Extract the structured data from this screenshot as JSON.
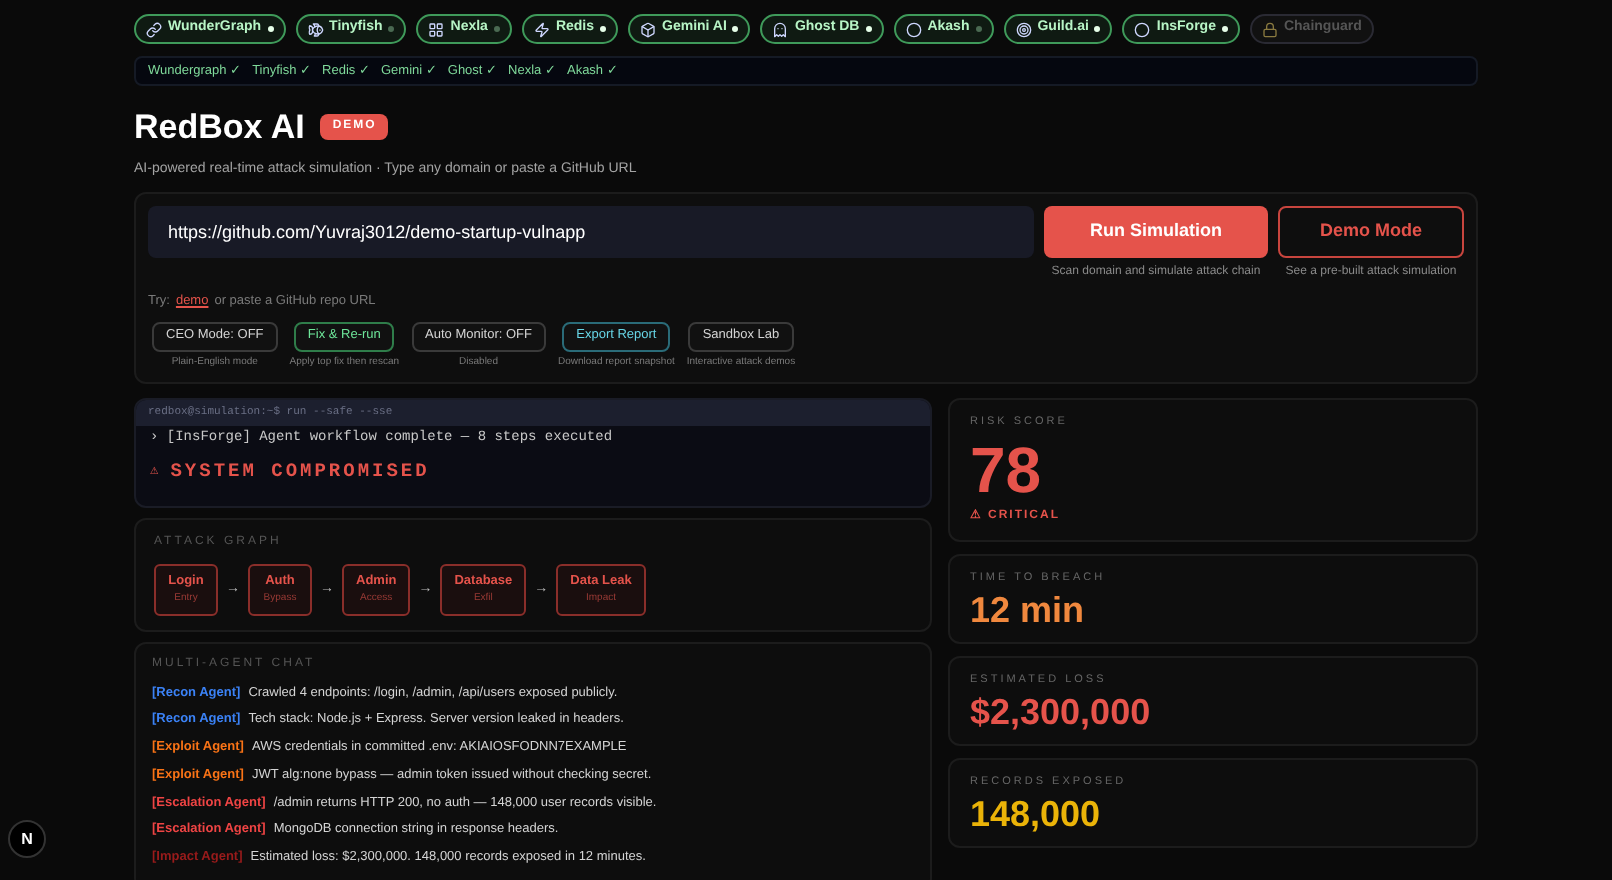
{
  "sponsors": [
    {
      "label": "WunderGraph",
      "kind": "link",
      "active": true,
      "disabled": false
    },
    {
      "label": "Tinyfish",
      "kind": "fish",
      "active": false,
      "disabled": false
    },
    {
      "label": "Nexla",
      "kind": "grid",
      "active": false,
      "disabled": false
    },
    {
      "label": "Redis",
      "kind": "bolt",
      "active": true,
      "disabled": false
    },
    {
      "label": "Gemini AI",
      "kind": "box",
      "active": true,
      "disabled": false
    },
    {
      "label": "Ghost DB",
      "kind": "ghost",
      "active": true,
      "disabled": false
    },
    {
      "label": "Akash",
      "kind": "circle",
      "active": false,
      "disabled": false
    },
    {
      "label": "Guild.ai",
      "kind": "target",
      "active": true,
      "disabled": false
    },
    {
      "label": "InsForge",
      "kind": "circle",
      "active": true,
      "disabled": false
    },
    {
      "label": "Chainguard",
      "kind": "lock",
      "disabled": true
    }
  ],
  "verified": [
    "Wundergraph ✓",
    "Tinyfish ✓",
    "Redis ✓",
    "Gemini ✓",
    "Ghost ✓",
    "Nexla ✓",
    "Akash ✓"
  ],
  "title": "RedBox AI",
  "badge": "DEMO",
  "subtitle": "AI-powered real-time attack simulation · Type any domain or paste a GitHub URL",
  "target_field": {
    "value": "https://github.com/Yuvraj3012/demo-startup-vulnapp"
  },
  "run_button": {
    "label": "Run Simulation",
    "caption": "Scan domain and simulate attack chain"
  },
  "demo_button": {
    "label": "Demo Mode",
    "caption": "See a pre-built attack simulation"
  },
  "hint": {
    "prefix": "Try:",
    "link": "demo",
    "suffix": "or paste a GitHub repo URL"
  },
  "tools": [
    {
      "label": "CEO Mode: OFF",
      "caption": "Plain-English mode",
      "kind": "neutral"
    },
    {
      "label": "Fix & Re-run",
      "caption": "Apply top fix then rescan",
      "kind": "success"
    },
    {
      "label": "Auto Monitor: OFF",
      "caption": "Disabled",
      "kind": "neutral"
    },
    {
      "label": "Export Report",
      "caption": "Download report snapshot",
      "kind": "info"
    },
    {
      "label": "Sandbox Lab",
      "caption": "Interactive attack demos",
      "kind": "neutral"
    }
  ],
  "terminal": {
    "prompt": "redbox@simulation:~$ run --safe --sse",
    "line": "› [InsForge] Agent workflow complete — 8 steps executed",
    "alert_icon": "⚠",
    "alert": "SYSTEM COMPROMISED"
  },
  "attack_graph": {
    "title": "ATTACK GRAPH",
    "arrow": "→",
    "nodes": [
      {
        "label": "Login",
        "sub": "Entry"
      },
      {
        "label": "Auth",
        "sub": "Bypass"
      },
      {
        "label": "Admin",
        "sub": "Access"
      },
      {
        "label": "Database",
        "sub": "Exfil"
      },
      {
        "label": "Data Leak",
        "sub": "Impact"
      }
    ]
  },
  "chat": {
    "title": "MULTI-AGENT CHAT",
    "messages": [
      {
        "agent": "[Recon Agent]",
        "color": "#3b82f6",
        "text": "Crawled 4 endpoints: /login, /admin, /api/users exposed publicly."
      },
      {
        "agent": "[Recon Agent]",
        "color": "#3b82f6",
        "text": "Tech stack: Node.js + Express. Server version leaked in headers."
      },
      {
        "agent": "[Exploit Agent]",
        "color": "#f97316",
        "text": "AWS credentials in committed .env: AKIAIOSFODNN7EXAMPLE"
      },
      {
        "agent": "[Exploit Agent]",
        "color": "#f97316",
        "text": "JWT alg:none bypass — admin token issued without checking secret."
      },
      {
        "agent": "[Escalation Agent]",
        "color": "#ef4444",
        "text": "/admin returns HTTP 200, no auth — 148,000 user records visible."
      },
      {
        "agent": "[Escalation Agent]",
        "color": "#ef4444",
        "text": "MongoDB connection string in response headers."
      },
      {
        "agent": "[Impact Agent]",
        "color": "#991b1b",
        "text": "Estimated loss: $2,300,000. 148,000 records exposed in 12 minutes."
      }
    ]
  },
  "metrics": [
    {
      "label": "RISK SCORE",
      "value": "78",
      "color": "#e5534b",
      "big": true,
      "note_icon": "⚠",
      "note": "CRITICAL"
    },
    {
      "label": "TIME TO BREACH",
      "value": "12 min",
      "color": "#f0883e",
      "big": false
    },
    {
      "label": "ESTIMATED LOSS",
      "value": "$2,300,000",
      "color": "#e5534b",
      "big": false
    },
    {
      "label": "RECORDS EXPOSED",
      "value": "148,000",
      "color": "#eab308",
      "big": false
    }
  ],
  "corner_badge": "N"
}
